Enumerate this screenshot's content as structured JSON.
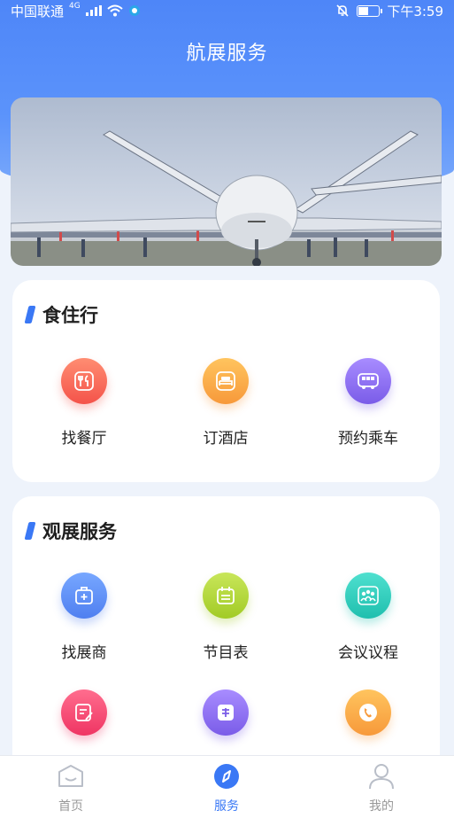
{
  "status_bar": {
    "carrier": "中国联通",
    "network": "4G",
    "time": "下午3:59"
  },
  "header": {
    "title": "航展服务"
  },
  "section_food": {
    "title": "食住行",
    "items": [
      {
        "label": "找餐厅",
        "icon": "restaurant-icon",
        "color": "#f86a55"
      },
      {
        "label": "订酒店",
        "icon": "hotel-bed-icon",
        "color": "#f9a53b"
      },
      {
        "label": "预约乘车",
        "icon": "bus-icon",
        "color": "#8c6cf2"
      }
    ]
  },
  "section_expo": {
    "title": "观展服务",
    "items": [
      {
        "label": "找展商",
        "icon": "briefcase-plus-icon",
        "color": "#4f86f7"
      },
      {
        "label": "节目表",
        "icon": "calendar-icon",
        "color": "#a7d22f"
      },
      {
        "label": "会议议程",
        "icon": "meeting-icon",
        "color": "#22c9b6"
      },
      {
        "label": "",
        "icon": "edit-form-icon",
        "color": "#f5446d"
      },
      {
        "label": "",
        "icon": "help-icon",
        "color": "#8c6cf2"
      },
      {
        "label": "",
        "icon": "phone-icon",
        "color": "#f9a53b"
      }
    ]
  },
  "tabbar": {
    "items": [
      {
        "label": "首页",
        "icon": "home-icon",
        "active": false
      },
      {
        "label": "服务",
        "icon": "compass-icon",
        "active": true
      },
      {
        "label": "我的",
        "icon": "user-icon",
        "active": false
      }
    ]
  },
  "colors": {
    "accent": "#3a78f5",
    "header": "#4e86f8"
  }
}
